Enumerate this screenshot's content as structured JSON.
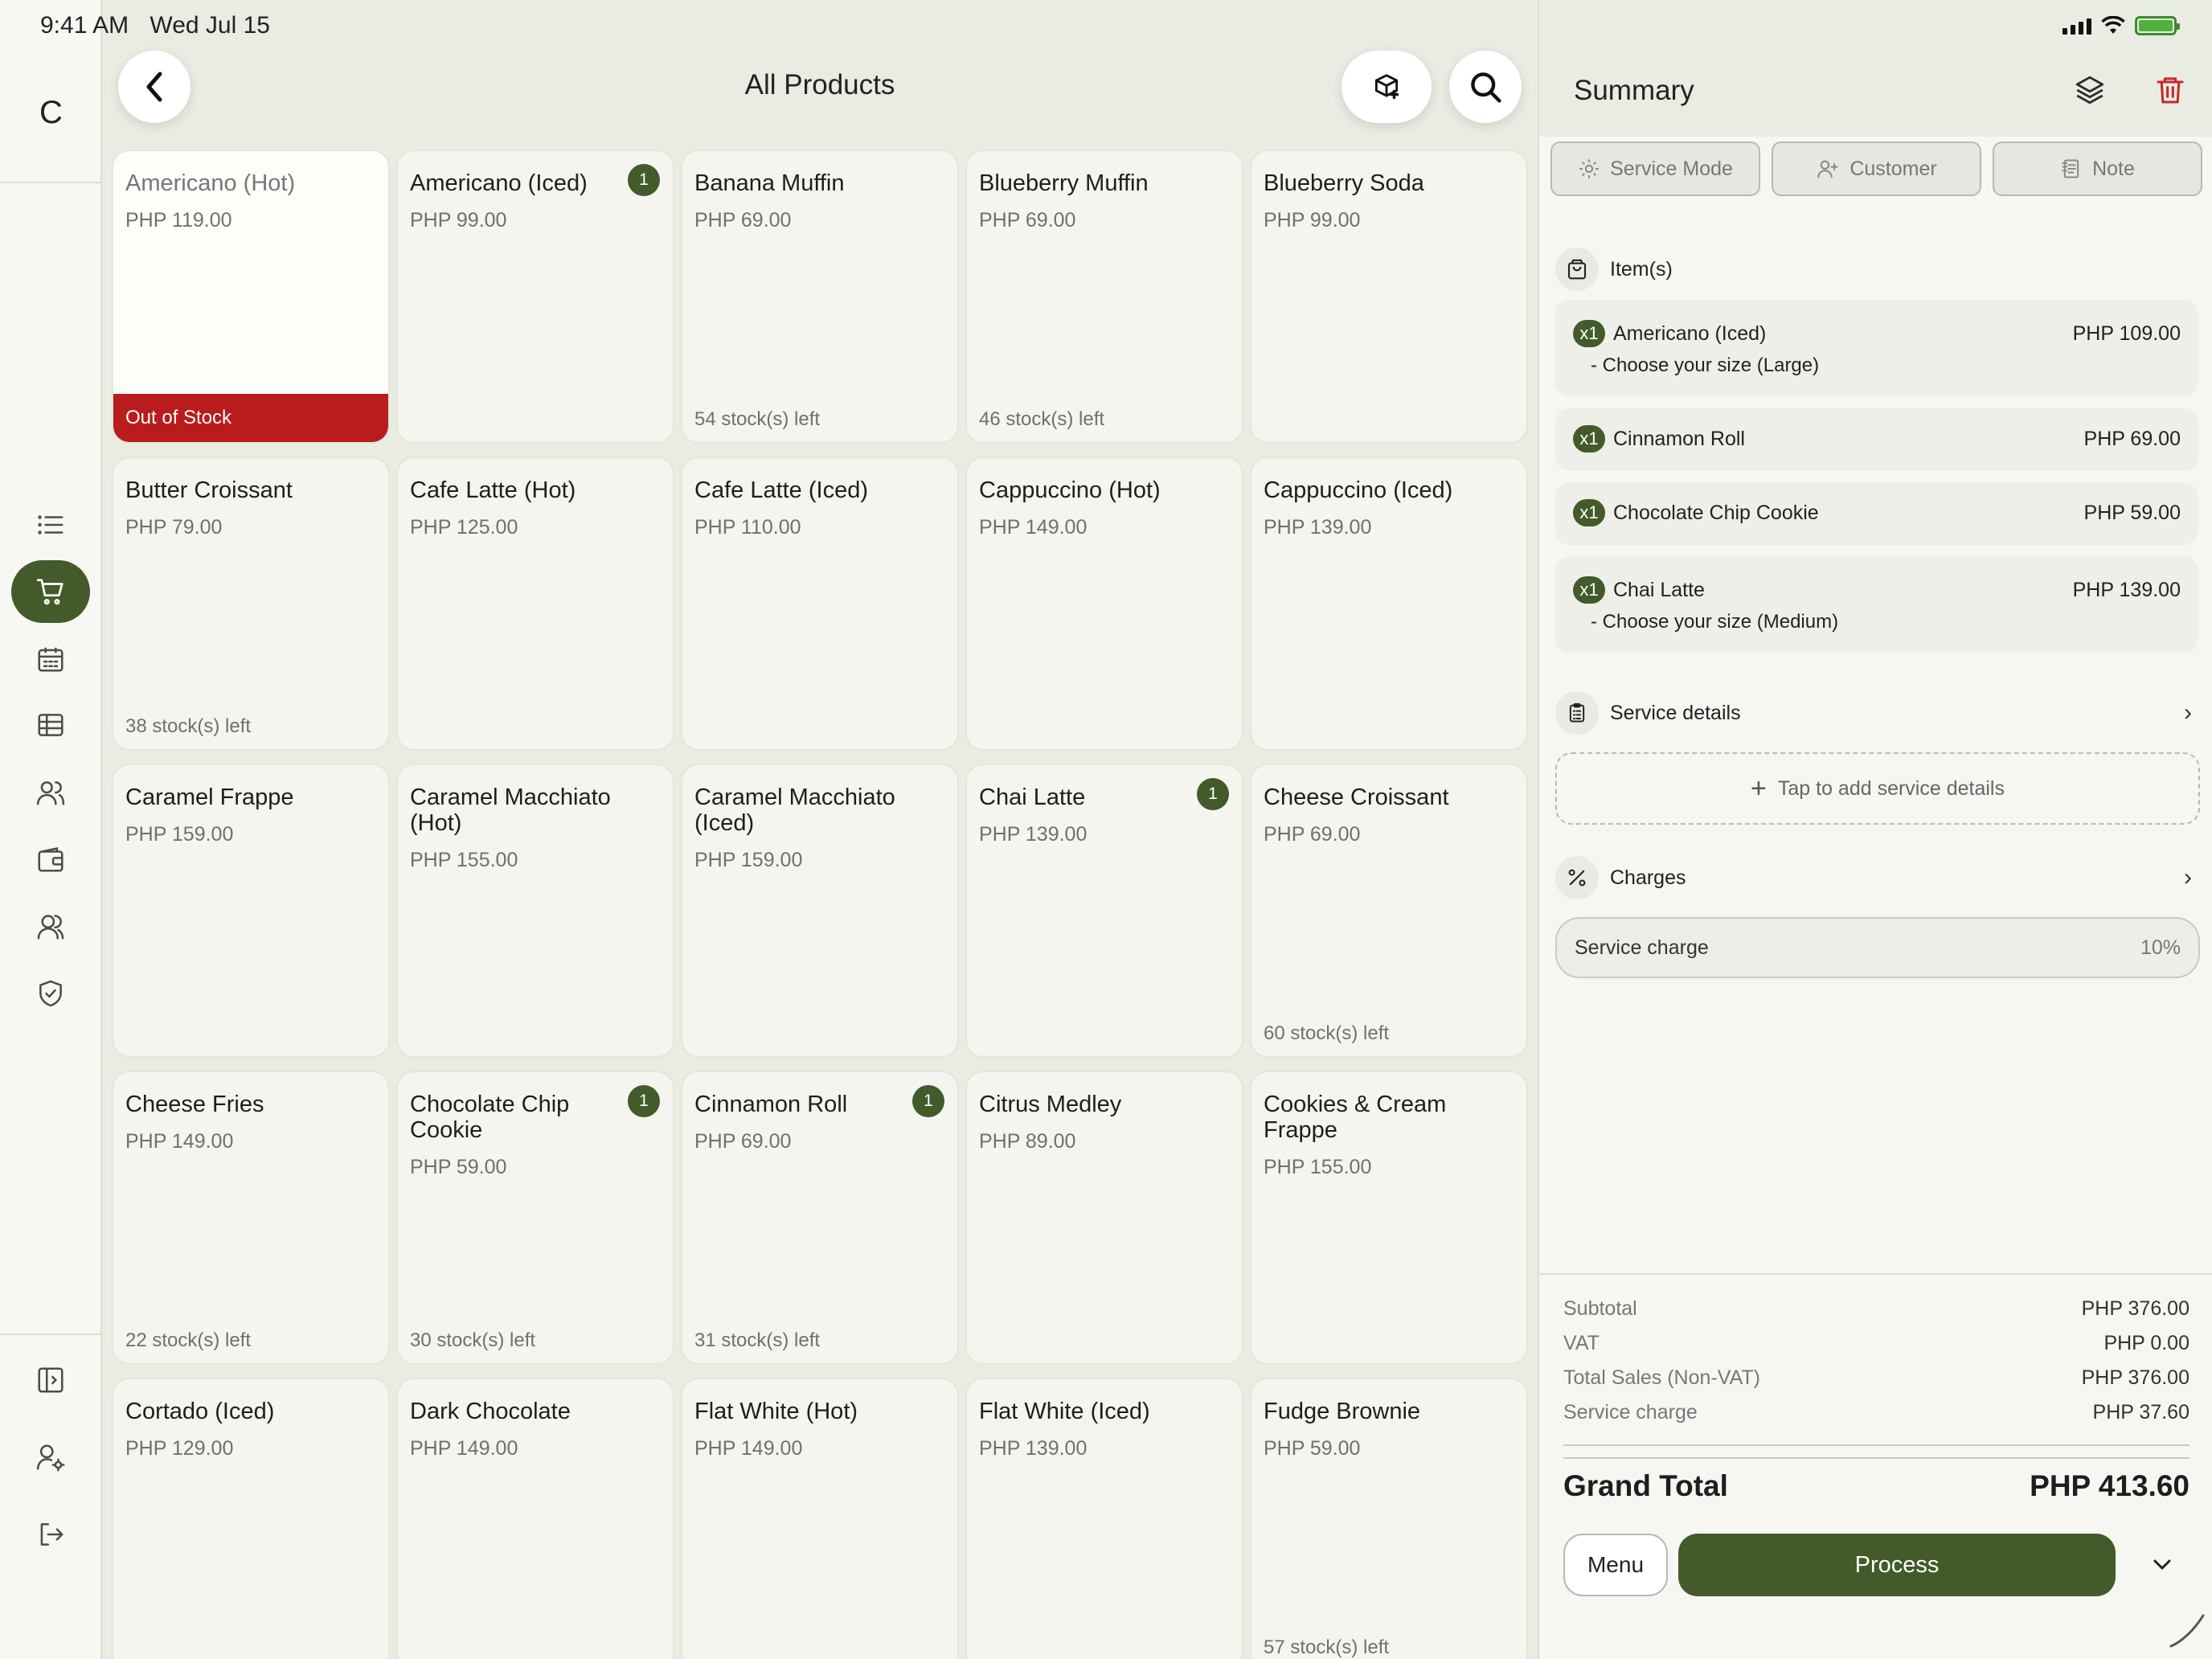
{
  "status": {
    "time": "9:41 AM",
    "date": "Wed Jul 15"
  },
  "rail": {
    "logo": "C"
  },
  "header": {
    "title": "All Products"
  },
  "products": [
    {
      "name": "Americano (Hot)",
      "price": "PHP 119.00",
      "stock": "",
      "badge": "",
      "oos": "Out of Stock"
    },
    {
      "name": "Americano (Iced)",
      "price": "PHP 99.00",
      "stock": "",
      "badge": "1",
      "oos": ""
    },
    {
      "name": "Banana Muffin",
      "price": "PHP 69.00",
      "stock": "54 stock(s) left",
      "badge": "",
      "oos": ""
    },
    {
      "name": "Blueberry Muffin",
      "price": "PHP 69.00",
      "stock": "46 stock(s) left",
      "badge": "",
      "oos": ""
    },
    {
      "name": "Blueberry Soda",
      "price": "PHP 99.00",
      "stock": "",
      "badge": "",
      "oos": ""
    },
    {
      "name": "Butter Croissant",
      "price": "PHP 79.00",
      "stock": "38 stock(s) left",
      "badge": "",
      "oos": ""
    },
    {
      "name": "Cafe Latte (Hot)",
      "price": "PHP 125.00",
      "stock": "",
      "badge": "",
      "oos": ""
    },
    {
      "name": "Cafe Latte (Iced)",
      "price": "PHP 110.00",
      "stock": "",
      "badge": "",
      "oos": ""
    },
    {
      "name": "Cappuccino (Hot)",
      "price": "PHP 149.00",
      "stock": "",
      "badge": "",
      "oos": ""
    },
    {
      "name": "Cappuccino (Iced)",
      "price": "PHP 139.00",
      "stock": "",
      "badge": "",
      "oos": ""
    },
    {
      "name": "Caramel Frappe",
      "price": "PHP 159.00",
      "stock": "",
      "badge": "",
      "oos": ""
    },
    {
      "name": "Caramel Macchiato (Hot)",
      "price": "PHP 155.00",
      "stock": "",
      "badge": "",
      "oos": ""
    },
    {
      "name": "Caramel Macchiato (Iced)",
      "price": "PHP 159.00",
      "stock": "",
      "badge": "",
      "oos": ""
    },
    {
      "name": "Chai Latte",
      "price": "PHP 139.00",
      "stock": "",
      "badge": "1",
      "oos": ""
    },
    {
      "name": "Cheese Croissant",
      "price": "PHP 69.00",
      "stock": "60 stock(s) left",
      "badge": "",
      "oos": ""
    },
    {
      "name": "Cheese Fries",
      "price": "PHP 149.00",
      "stock": "22 stock(s) left",
      "badge": "",
      "oos": ""
    },
    {
      "name": "Chocolate Chip Cookie",
      "price": "PHP 59.00",
      "stock": "30 stock(s) left",
      "badge": "1",
      "oos": ""
    },
    {
      "name": "Cinnamon Roll",
      "price": "PHP 69.00",
      "stock": "31 stock(s) left",
      "badge": "1",
      "oos": ""
    },
    {
      "name": "Citrus Medley",
      "price": "PHP 89.00",
      "stock": "",
      "badge": "",
      "oos": ""
    },
    {
      "name": "Cookies & Cream Frappe",
      "price": "PHP 155.00",
      "stock": "",
      "badge": "",
      "oos": ""
    },
    {
      "name": "Cortado (Iced)",
      "price": "PHP 129.00",
      "stock": "",
      "badge": "",
      "oos": ""
    },
    {
      "name": "Dark Chocolate",
      "price": "PHP 149.00",
      "stock": "",
      "badge": "",
      "oos": ""
    },
    {
      "name": "Flat White (Hot)",
      "price": "PHP 149.00",
      "stock": "",
      "badge": "",
      "oos": ""
    },
    {
      "name": "Flat White (Iced)",
      "price": "PHP 139.00",
      "stock": "",
      "badge": "",
      "oos": ""
    },
    {
      "name": "Fudge Brownie",
      "price": "PHP 59.00",
      "stock": "57 stock(s) left",
      "badge": "",
      "oos": ""
    }
  ],
  "summary": {
    "title": "Summary",
    "tabs": {
      "service_mode": "Service Mode",
      "customer": "Customer",
      "note": "Note"
    },
    "items_label": "Item(s)",
    "items": [
      {
        "qty": "x1",
        "name": "Americano (Iced)",
        "price": "PHP 109.00",
        "option": "- Choose your size (Large)"
      },
      {
        "qty": "x1",
        "name": "Cinnamon Roll",
        "price": "PHP 69.00",
        "option": ""
      },
      {
        "qty": "x1",
        "name": "Chocolate Chip Cookie",
        "price": "PHP 59.00",
        "option": ""
      },
      {
        "qty": "x1",
        "name": "Chai Latte",
        "price": "PHP 139.00",
        "option": "- Choose your size (Medium)"
      }
    ],
    "service_details_label": "Service details",
    "add_service_details": "Tap to add service details",
    "charges_label": "Charges",
    "service_charge": {
      "label": "Service charge",
      "value": "10%"
    },
    "totals": {
      "subtotal_label": "Subtotal",
      "subtotal": "PHP 376.00",
      "vat_label": "VAT",
      "vat": "PHP 0.00",
      "total_sales_label": "Total Sales (Non-VAT)",
      "total_sales": "PHP 376.00",
      "service_charge_label": "Service charge",
      "service_charge": "PHP 37.60",
      "grand_total_label": "Grand Total",
      "grand_total": "PHP 413.60"
    },
    "menu_label": "Menu",
    "process_label": "Process"
  },
  "colors": {
    "accent": "#435a2a",
    "danger": "#b91c1c",
    "header_bg": "#e8ece2"
  }
}
